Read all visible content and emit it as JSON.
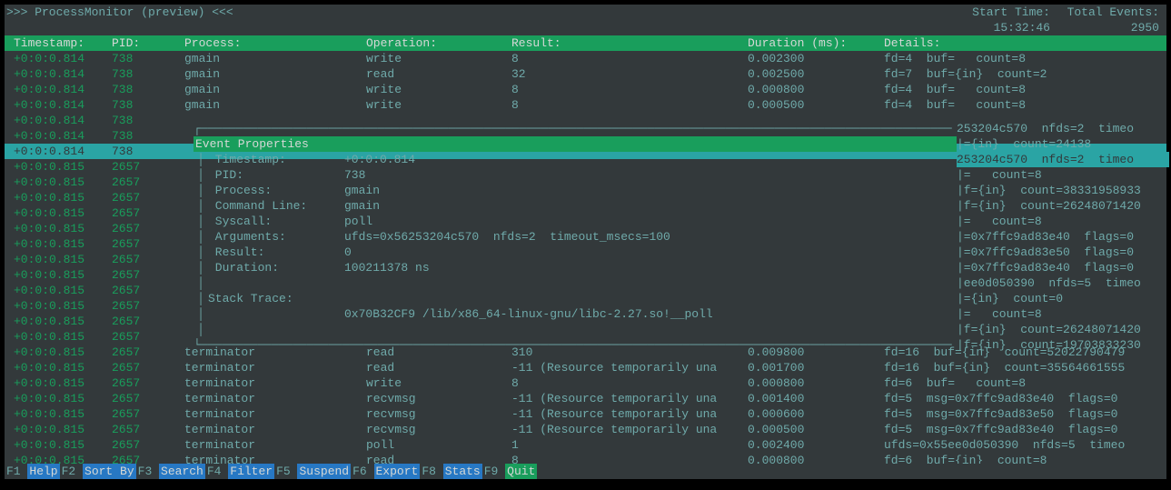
{
  "title_left": ">>> ProcessMonitor (preview) <<<",
  "title_start_label": "Start Time:",
  "title_total_label": "Total Events:",
  "start_time": "15:32:46",
  "total_events": "2950",
  "headers": {
    "ts": "Timestamp:",
    "pid": "PID:",
    "proc": "Process:",
    "op": "Operation:",
    "res": "Result:",
    "dur": "Duration (ms):",
    "det": "Details:"
  },
  "rows": [
    {
      "ts": "+0:0:0.814",
      "pid": "738",
      "proc": "gmain",
      "op": "write",
      "res": "8",
      "dur": "0.002300",
      "det": "fd=4  buf=   count=8"
    },
    {
      "ts": "+0:0:0.814",
      "pid": "738",
      "proc": "gmain",
      "op": "read",
      "res": "32",
      "dur": "0.002500",
      "det": "fd=7  buf={in}  count=2"
    },
    {
      "ts": "+0:0:0.814",
      "pid": "738",
      "proc": "gmain",
      "op": "write",
      "res": "8",
      "dur": "0.000800",
      "det": "fd=4  buf=   count=8"
    },
    {
      "ts": "+0:0:0.814",
      "pid": "738",
      "proc": "gmain",
      "op": "write",
      "res": "8",
      "dur": "0.000500",
      "det": "fd=4  buf=   count=8"
    },
    {
      "ts": "+0:0:0.814",
      "pid": "738",
      "proc": "",
      "op": "",
      "res": "",
      "dur": "",
      "det": ""
    },
    {
      "ts": "+0:0:0.814",
      "pid": "738",
      "proc": "",
      "op": "",
      "res": "",
      "dur": "",
      "det": ""
    },
    {
      "ts": "+0:0:0.814",
      "pid": "738",
      "proc": "",
      "op": "",
      "res": "",
      "dur": "",
      "det": "",
      "sel": true
    },
    {
      "ts": "+0:0:0.815",
      "pid": "2657",
      "proc": "",
      "op": "",
      "res": "",
      "dur": "",
      "det": ""
    },
    {
      "ts": "+0:0:0.815",
      "pid": "2657",
      "proc": "",
      "op": "",
      "res": "",
      "dur": "",
      "det": ""
    },
    {
      "ts": "+0:0:0.815",
      "pid": "2657",
      "proc": "",
      "op": "",
      "res": "",
      "dur": "",
      "det": ""
    },
    {
      "ts": "+0:0:0.815",
      "pid": "2657",
      "proc": "",
      "op": "",
      "res": "",
      "dur": "",
      "det": ""
    },
    {
      "ts": "+0:0:0.815",
      "pid": "2657",
      "proc": "",
      "op": "",
      "res": "",
      "dur": "",
      "det": ""
    },
    {
      "ts": "+0:0:0.815",
      "pid": "2657",
      "proc": "",
      "op": "",
      "res": "",
      "dur": "",
      "det": ""
    },
    {
      "ts": "+0:0:0.815",
      "pid": "2657",
      "proc": "",
      "op": "",
      "res": "",
      "dur": "",
      "det": ""
    },
    {
      "ts": "+0:0:0.815",
      "pid": "2657",
      "proc": "",
      "op": "",
      "res": "",
      "dur": "",
      "det": ""
    },
    {
      "ts": "+0:0:0.815",
      "pid": "2657",
      "proc": "",
      "op": "",
      "res": "",
      "dur": "",
      "det": ""
    },
    {
      "ts": "+0:0:0.815",
      "pid": "2657",
      "proc": "",
      "op": "",
      "res": "",
      "dur": "",
      "det": ""
    },
    {
      "ts": "+0:0:0.815",
      "pid": "2657",
      "proc": "",
      "op": "",
      "res": "",
      "dur": "",
      "det": ""
    },
    {
      "ts": "+0:0:0.815",
      "pid": "2657",
      "proc": "",
      "op": "",
      "res": "",
      "dur": "",
      "det": ""
    },
    {
      "ts": "+0:0:0.815",
      "pid": "2657",
      "proc": "terminator",
      "op": "read",
      "res": "310",
      "dur": "0.009800",
      "det": "fd=16  buf={in}  count=52022790479"
    },
    {
      "ts": "+0:0:0.815",
      "pid": "2657",
      "proc": "terminator",
      "op": "read",
      "res": "-11 (Resource temporarily una",
      "dur": "0.001700",
      "det": "fd=16  buf={in}  count=35564661555"
    },
    {
      "ts": "+0:0:0.815",
      "pid": "2657",
      "proc": "terminator",
      "op": "write",
      "res": "8",
      "dur": "0.000800",
      "det": "fd=6  buf=   count=8"
    },
    {
      "ts": "+0:0:0.815",
      "pid": "2657",
      "proc": "terminator",
      "op": "recvmsg",
      "res": "-11 (Resource temporarily una",
      "dur": "0.001400",
      "det": "fd=5  msg=0x7ffc9ad83e40  flags=0"
    },
    {
      "ts": "+0:0:0.815",
      "pid": "2657",
      "proc": "terminator",
      "op": "recvmsg",
      "res": "-11 (Resource temporarily una",
      "dur": "0.000600",
      "det": "fd=5  msg=0x7ffc9ad83e50  flags=0"
    },
    {
      "ts": "+0:0:0.815",
      "pid": "2657",
      "proc": "terminator",
      "op": "recvmsg",
      "res": "-11 (Resource temporarily una",
      "dur": "0.000500",
      "det": "fd=5  msg=0x7ffc9ad83e40  flags=0"
    },
    {
      "ts": "+0:0:0.815",
      "pid": "2657",
      "proc": "terminator",
      "op": "poll",
      "res": "1",
      "dur": "0.002400",
      "det": "ufds=0x55ee0d050390  nfds=5  timeo"
    },
    {
      "ts": "+0:0:0.815",
      "pid": "2657",
      "proc": "terminator",
      "op": "read",
      "res": "8",
      "dur": "0.000800",
      "det": "fd=6  buf={in}  count=8"
    }
  ],
  "popup": {
    "title": "Event Properties",
    "fields": [
      {
        "label": "Timestamp:",
        "value": "+0:0:0.814"
      },
      {
        "label": "PID:",
        "value": "738"
      },
      {
        "label": "Process:",
        "value": "gmain"
      },
      {
        "label": "Command Line:",
        "value": "gmain"
      },
      {
        "label": "Syscall:",
        "value": "poll"
      },
      {
        "label": "Arguments:",
        "value": "ufds=0x56253204c570  nfds=2  timeout_msecs=100"
      },
      {
        "label": "Result:",
        "value": "0"
      },
      {
        "label": "Duration:",
        "value": "100211378 ns"
      }
    ],
    "stack_label": "Stack Trace:",
    "stack_line": "0x70B32CF9 /lib/x86_64-linux-gnu/libc-2.27.so!__poll"
  },
  "details_right": [
    "253204c570  nfds=2  timeo",
    "|={in}  count=24138",
    "253204c570  nfds=2  timeo",
    "|=   count=8",
    "|f={in}  count=38331958933",
    "|f={in}  count=26248071420",
    "|=   count=8",
    "|=0x7ffc9ad83e40  flags=0",
    "|=0x7ffc9ad83e50  flags=0",
    "|=0x7ffc9ad83e40  flags=0",
    "|ee0d050390  nfds=5  timeo",
    "|={in}  count=0",
    "|=   count=8",
    "|f={in}  count=26248071420",
    "|f={in}  count=19703833230"
  ],
  "footer": [
    {
      "key": "F1",
      "label": "Help"
    },
    {
      "key": "F2",
      "label": "Sort By"
    },
    {
      "key": "F3",
      "label": "Search"
    },
    {
      "key": "F4",
      "label": "Filter"
    },
    {
      "key": "F5",
      "label": "Suspend"
    },
    {
      "key": "F6",
      "label": "Export"
    },
    {
      "key": "F8",
      "label": "Stats"
    },
    {
      "key": "F9",
      "label": "Quit"
    }
  ]
}
